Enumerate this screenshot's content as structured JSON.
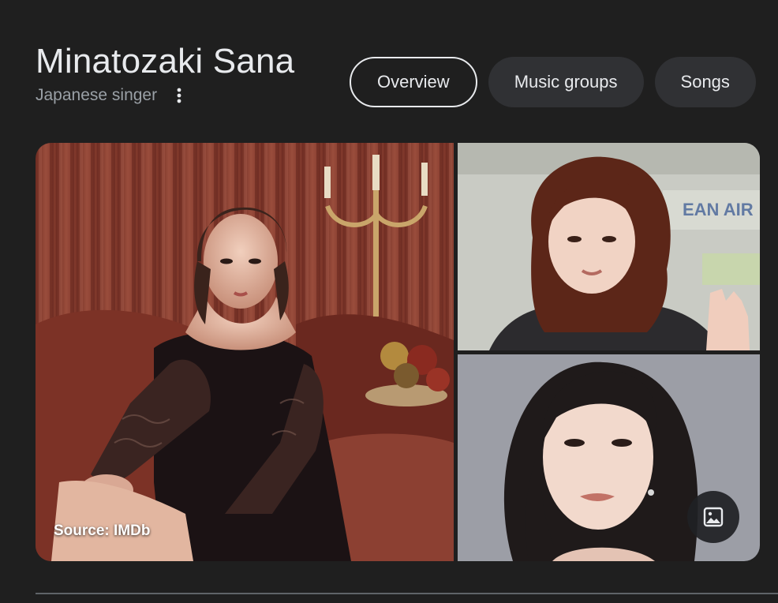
{
  "header": {
    "title": "Minatozaki Sana",
    "subtitle": "Japanese singer",
    "more_icon": "more-vert-icon"
  },
  "tabs": [
    {
      "label": "Overview",
      "active": true
    },
    {
      "label": "Music groups",
      "active": false
    },
    {
      "label": "Songs",
      "active": false
    }
  ],
  "gallery": {
    "source_label": "Source: IMDb",
    "image_button_icon": "image-icon"
  },
  "colors": {
    "background": "#1f1f1f",
    "chip": "#303134",
    "text": "#e8eaed",
    "muted": "#9aa0a6"
  }
}
